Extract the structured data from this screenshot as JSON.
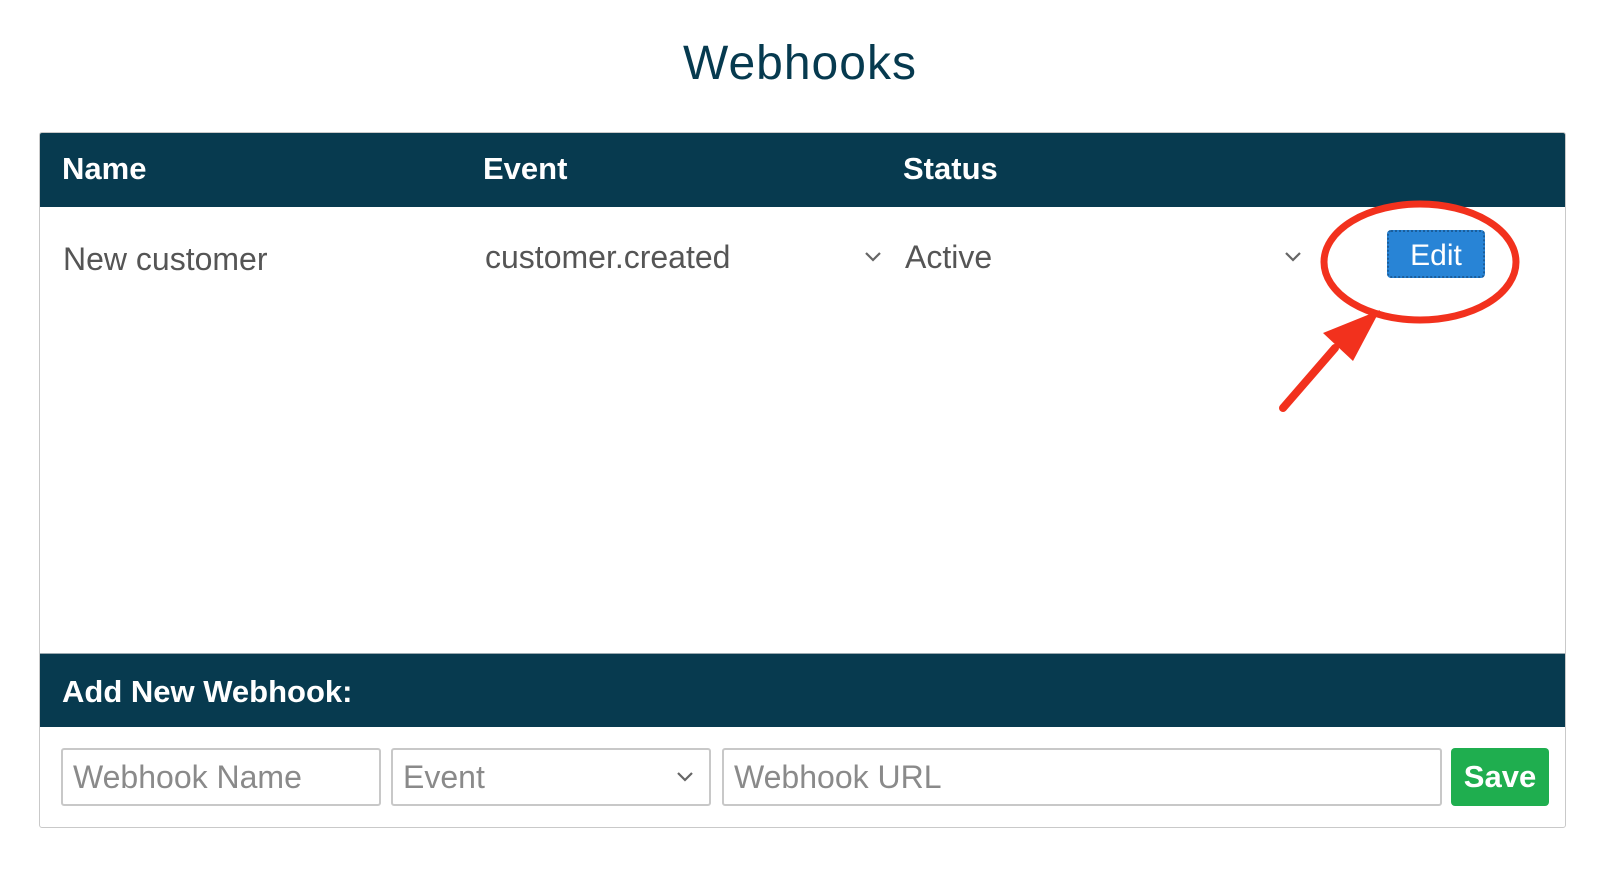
{
  "page": {
    "title": "Webhooks"
  },
  "table": {
    "headers": {
      "name": "Name",
      "event": "Event",
      "status": "Status"
    },
    "rows": [
      {
        "name": "New customer",
        "event": "customer.created",
        "status": "Active",
        "edit_label": "Edit"
      }
    ]
  },
  "add_form": {
    "heading": "Add New Webhook:",
    "name_placeholder": "Webhook Name",
    "event_placeholder": "Event",
    "url_placeholder": "Webhook URL",
    "save_label": "Save"
  },
  "colors": {
    "header_bg": "#073a4f",
    "edit_button": "#2884d6",
    "save_button": "#1fae4f",
    "annotation": "#f2311d"
  },
  "icons": {
    "select_arrow": "chevron-down-icon"
  }
}
